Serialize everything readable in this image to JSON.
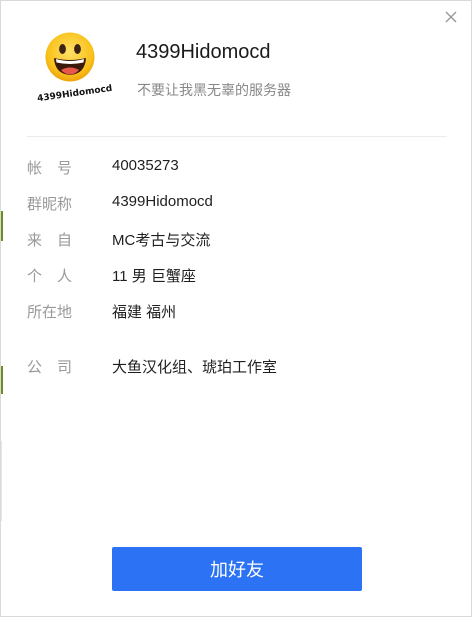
{
  "profile": {
    "nickname": "4399Hidomocd",
    "signature": "不要让我黑无辜的服务器",
    "avatar_icon": "grinning-face-icon",
    "avatar_sign_text": "4399Hidomocd"
  },
  "info": [
    {
      "label": "帐　号",
      "value": "40035273"
    },
    {
      "label": "群昵称",
      "value": "4399Hidomocd"
    },
    {
      "label": "来　自",
      "value": "MC考古与交流"
    },
    {
      "label": "个　人",
      "value": "11  男  巨蟹座"
    },
    {
      "label": "所在地",
      "value": "福建 福州"
    },
    {
      "label": "公　司",
      "value": "大鱼汉化组、琥珀工作室"
    }
  ],
  "actions": {
    "add_friend_label": "加好友",
    "close_icon": "close-icon"
  },
  "colors": {
    "primary_button": "#2b73f4",
    "label_gray": "#999999",
    "signature_gray": "#888888",
    "text_dark": "#1f1f1f"
  }
}
